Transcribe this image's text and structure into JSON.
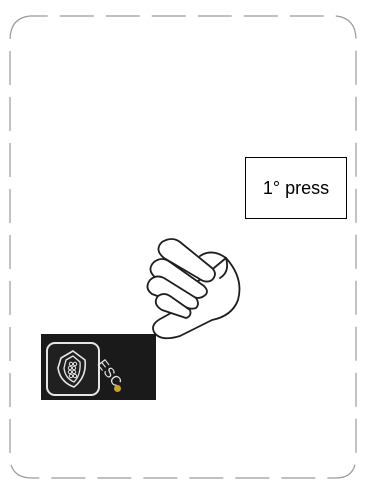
{
  "callout": {
    "text": "1° press"
  },
  "button": {
    "label": "ESC",
    "icon": "shield-icon"
  },
  "pointer": {
    "icon": "pointing-hand-icon"
  },
  "colors": {
    "panel": "#1a1a1a",
    "led": "#c9a227",
    "outline": "#9a9a9a"
  }
}
